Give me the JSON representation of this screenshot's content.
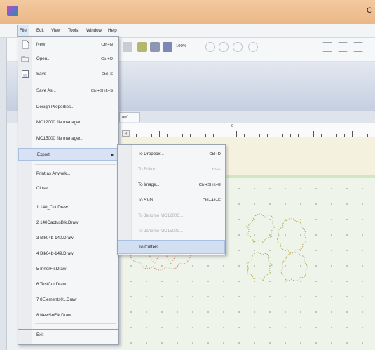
{
  "window": {
    "title": "C"
  },
  "menubar": {
    "items": [
      "File",
      "Edit",
      "View",
      "Tools",
      "Window",
      "Help"
    ]
  },
  "toolbar": {
    "zoom": "100%"
  },
  "document_tab": {
    "label": "aw*"
  },
  "ruler": {
    "label_zero": "0"
  },
  "file_menu": {
    "items": [
      {
        "label": "New",
        "shortcut": "Ctrl+N",
        "icon": "new-document-icon"
      },
      {
        "label": "Open...",
        "shortcut": "Ctrl+O",
        "icon": "open-folder-icon"
      },
      {
        "label": "Save",
        "shortcut": "Ctrl+S",
        "icon": "save-disk-icon"
      },
      {
        "label": "Save As...",
        "shortcut": "Ctrl+Shift+S"
      },
      {
        "label": "Design Properties..."
      },
      {
        "label": "MC12000 file manager..."
      },
      {
        "label": "MC15000 file manager..."
      },
      {
        "label": "Export"
      },
      {
        "label": "Print as Artwork..."
      },
      {
        "label": "Close"
      },
      {
        "label": "1 140_Cut.Draw"
      },
      {
        "label": "2 140CactusBlk.Draw"
      },
      {
        "label": "3 Blk04b-140.Draw"
      },
      {
        "label": "4 Blk04b-149.Draw"
      },
      {
        "label": "5 InnerFlr.Draw"
      },
      {
        "label": "6 TestCut.Draw"
      },
      {
        "label": "7 8Elements01.Draw"
      },
      {
        "label": "8 NewSnFlk.Draw"
      },
      {
        "label": "Exit"
      }
    ]
  },
  "export_submenu": {
    "items": [
      {
        "label": "To Dropbox...",
        "shortcut": "Ctrl+D",
        "enabled": true
      },
      {
        "label": "To Editor...",
        "shortcut": "Ctrl+E",
        "enabled": false
      },
      {
        "label": "To Image...",
        "shortcut": "Ctrl+Shift+E",
        "enabled": true
      },
      {
        "label": "To SVG...",
        "shortcut": "Ctrl+Alt+E",
        "enabled": true
      },
      {
        "label": "To Janome MC12000...",
        "shortcut": "",
        "enabled": false
      },
      {
        "label": "To Janome MC15000...",
        "shortcut": "",
        "enabled": false
      },
      {
        "label": "To Cutters...",
        "shortcut": "",
        "enabled": true
      }
    ]
  },
  "colors": {
    "accent": "#d7e3f4",
    "titlebar": "#eab888",
    "canvas": "#eef4ea",
    "shape_red": "#d7866f",
    "shape_olive": "#b9a64a"
  }
}
